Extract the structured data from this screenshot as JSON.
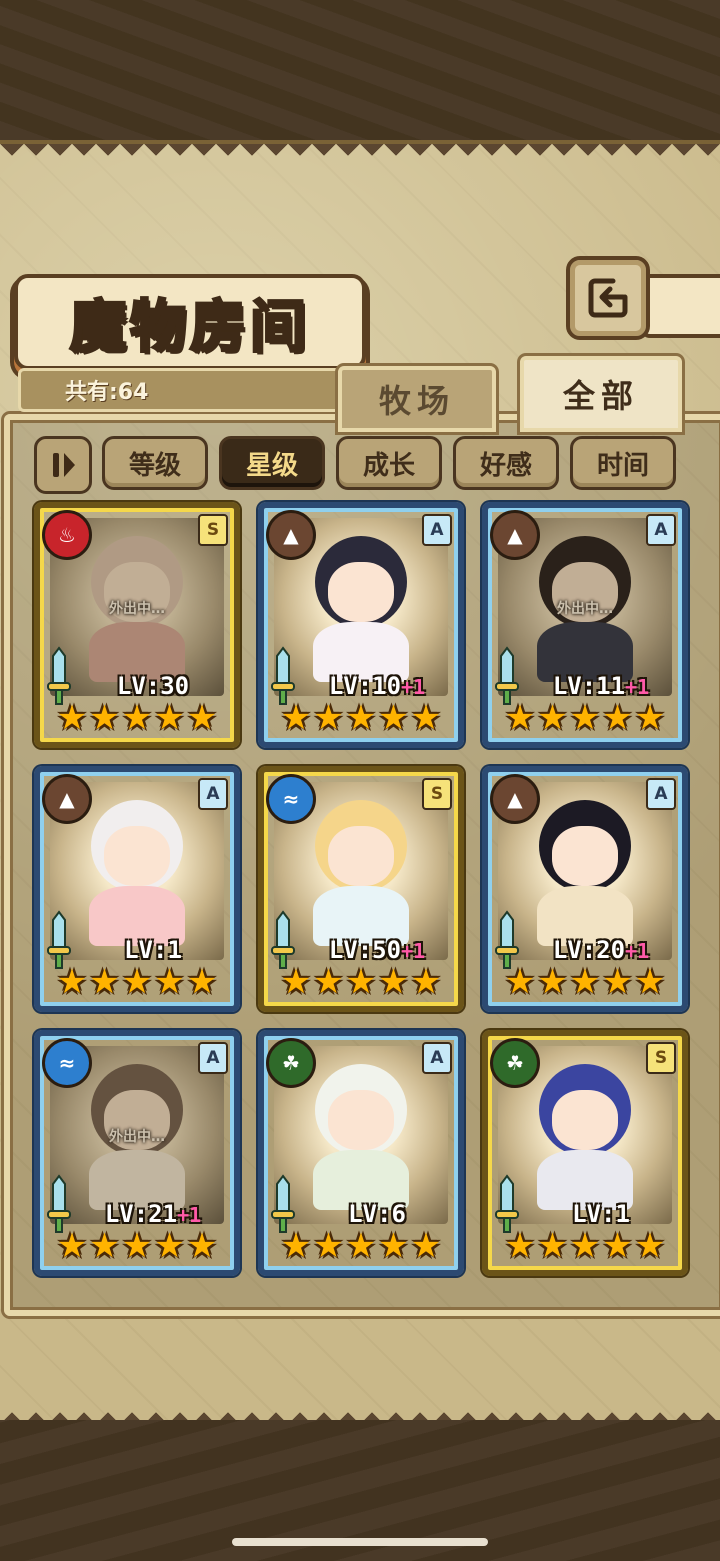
{
  "title": "魔物房间",
  "count_label": "共有:64",
  "tabs": [
    {
      "label": "牧场",
      "active": false
    },
    {
      "label": "全部",
      "active": true
    }
  ],
  "sort_buttons": [
    {
      "label": "等级",
      "active": false
    },
    {
      "label": "星级",
      "active": true
    },
    {
      "label": "成长",
      "active": false
    },
    {
      "label": "好感",
      "active": false
    },
    {
      "label": "时间",
      "active": false
    }
  ],
  "cards": [
    {
      "rank": "S",
      "element": "fire",
      "level": "LV:30",
      "plus": "",
      "away": "外出中…",
      "stars": 5,
      "hair": "#e8c9b8",
      "outfit": "#f0a8a0"
    },
    {
      "rank": "A",
      "element": "earth",
      "level": "LV:10",
      "plus": "+1",
      "away": "",
      "stars": 5,
      "hair": "#2b2a3a",
      "outfit": "#f7f1f5"
    },
    {
      "rank": "A",
      "element": "earth",
      "level": "LV:11",
      "plus": "+1",
      "away": "外出中…",
      "stars": 5,
      "hair": "#3a2a22",
      "outfit": "#3c4360"
    },
    {
      "rank": "A",
      "element": "earth",
      "level": "LV:1",
      "plus": "",
      "away": "",
      "stars": 5,
      "hair": "#f1eeee",
      "outfit": "#f8c8c8"
    },
    {
      "rank": "S",
      "element": "water",
      "level": "LV:50",
      "plus": "+1",
      "away": "",
      "stars": 5,
      "hair": "#f5d58a",
      "outfit": "#e8f4f7"
    },
    {
      "rank": "A",
      "element": "earth",
      "level": "LV:20",
      "plus": "+1",
      "away": "",
      "stars": 5,
      "hair": "#1c1a24",
      "outfit": "#f2e3c4"
    },
    {
      "rank": "A",
      "element": "water",
      "level": "LV:21",
      "plus": "+1",
      "away": "外出中…",
      "stars": 5,
      "hair": "#8a6a52",
      "outfit": "#f3efe8"
    },
    {
      "rank": "A",
      "element": "leaf",
      "level": "LV:6",
      "plus": "",
      "away": "",
      "stars": 5,
      "hair": "#f1f3ec",
      "outfit": "#e6efdc"
    },
    {
      "rank": "S",
      "element": "leaf",
      "level": "LV:1",
      "plus": "",
      "away": "",
      "stars": 5,
      "hair": "#3b45a0",
      "outfit": "#e9e9ef"
    }
  ],
  "element_colors": {
    "fire": "#c8242b",
    "earth": "#6b4631",
    "water": "#2d7fcf",
    "leaf": "#2f6a2a"
  },
  "element_icons": {
    "fire": "fire-icon",
    "earth": "mountain-icon",
    "water": "waves-icon",
    "leaf": "leaf-icon"
  }
}
